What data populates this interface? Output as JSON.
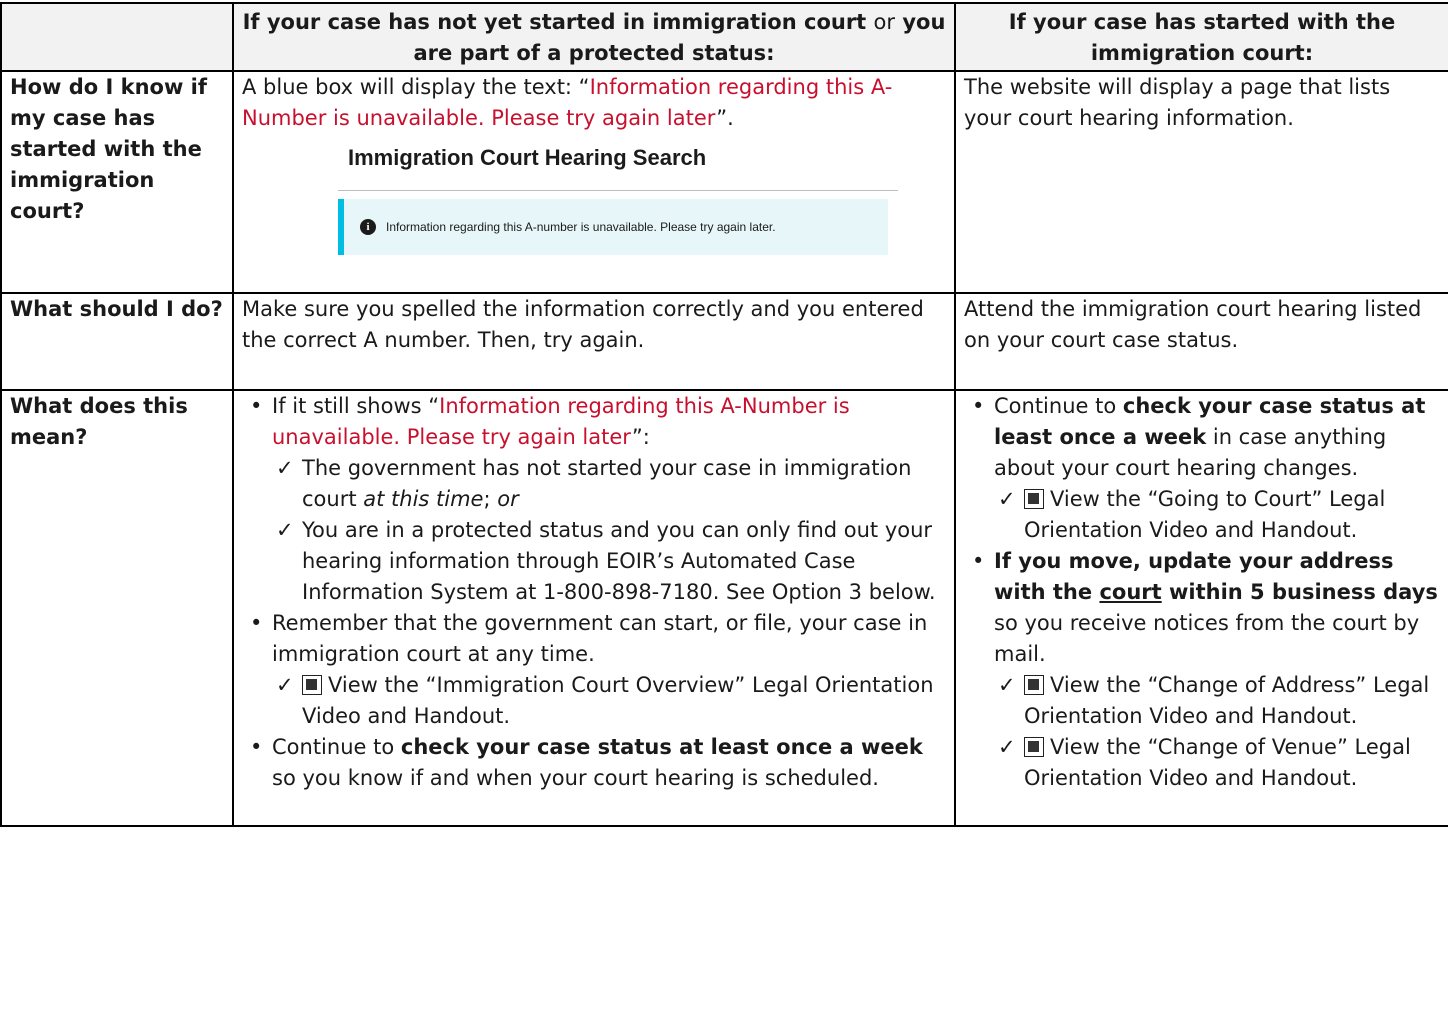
{
  "header": {
    "col1_a": "If your case has not yet started in immigration court",
    "col1_or": "or",
    "col1_b": "you are part of a protected status:",
    "col2": "If your case has started with the immigration court:"
  },
  "rows": {
    "know": {
      "label": "How do I know if my case has started with the immigration court?",
      "left_a": "A blue box will display the text: “",
      "left_red": "Information regarding this A-Number is unavailable. Please try again later",
      "left_b": "”.",
      "screenshot_title": "Immigration Court Hearing Search",
      "screenshot_alert": "Information regarding this A-number is unavailable. Please try again later.",
      "screenshot_info_icon": "info-icon",
      "right": "The website will display a page that lists your court hearing information."
    },
    "do": {
      "label": "What should I do?",
      "left": "Make sure you spelled the information correctly and you entered the correct A number. Then, try again.",
      "right": "Attend the immigration court hearing listed on your court case status."
    },
    "mean": {
      "label": "What does this mean?",
      "left": {
        "b1_a": "If it still shows “",
        "b1_red": "Information regarding this A-Number is unavailable. Please try again later",
        "b1_b": "”:",
        "c1_a": "The government has not started your case in immigration court ",
        "c1_i": "at this time",
        "c1_b": "; ",
        "c1_or": "or",
        "c2": "You are in a protected status and you can only find out your hearing information through EOIR’s Automated Case Information System at 1-800-898-7180. See Option 3 below.",
        "b2": "Remember that the government can start, or file, your case in immigration court at any time.",
        "c3": "View the “Immigration Court Overview” Legal Orientation Video and Handout.",
        "b3_a": "Continue to ",
        "b3_bold": "check your case status at least once a week",
        "b3_b": " so you know if and when your court hearing is scheduled."
      },
      "right": {
        "b1_a": "Continue to ",
        "b1_bold": "check your case status at least once a week",
        "b1_b": " in case anything about your court hearing changes.",
        "c1": "View the “Going to Court” Legal Orientation Video and Handout.",
        "b2_a": "If you move, update your address with the ",
        "b2_u": "court",
        "b2_b": " within 5 business days",
        "b2_c": " so you receive notices from the court by mail.",
        "c2": "View the “Change of Address” Legal Orientation Video and Handout.",
        "c3": "View the “Change of Venue” Legal Orientation Video and Handout."
      }
    }
  },
  "glyphs": {
    "check": "✓",
    "video_icon": "film-icon"
  },
  "colors": {
    "red_text": "#c8102e",
    "alert_bg": "#e7f6f8",
    "alert_border": "#00bde3",
    "header_bg": "#f2f2f2"
  }
}
